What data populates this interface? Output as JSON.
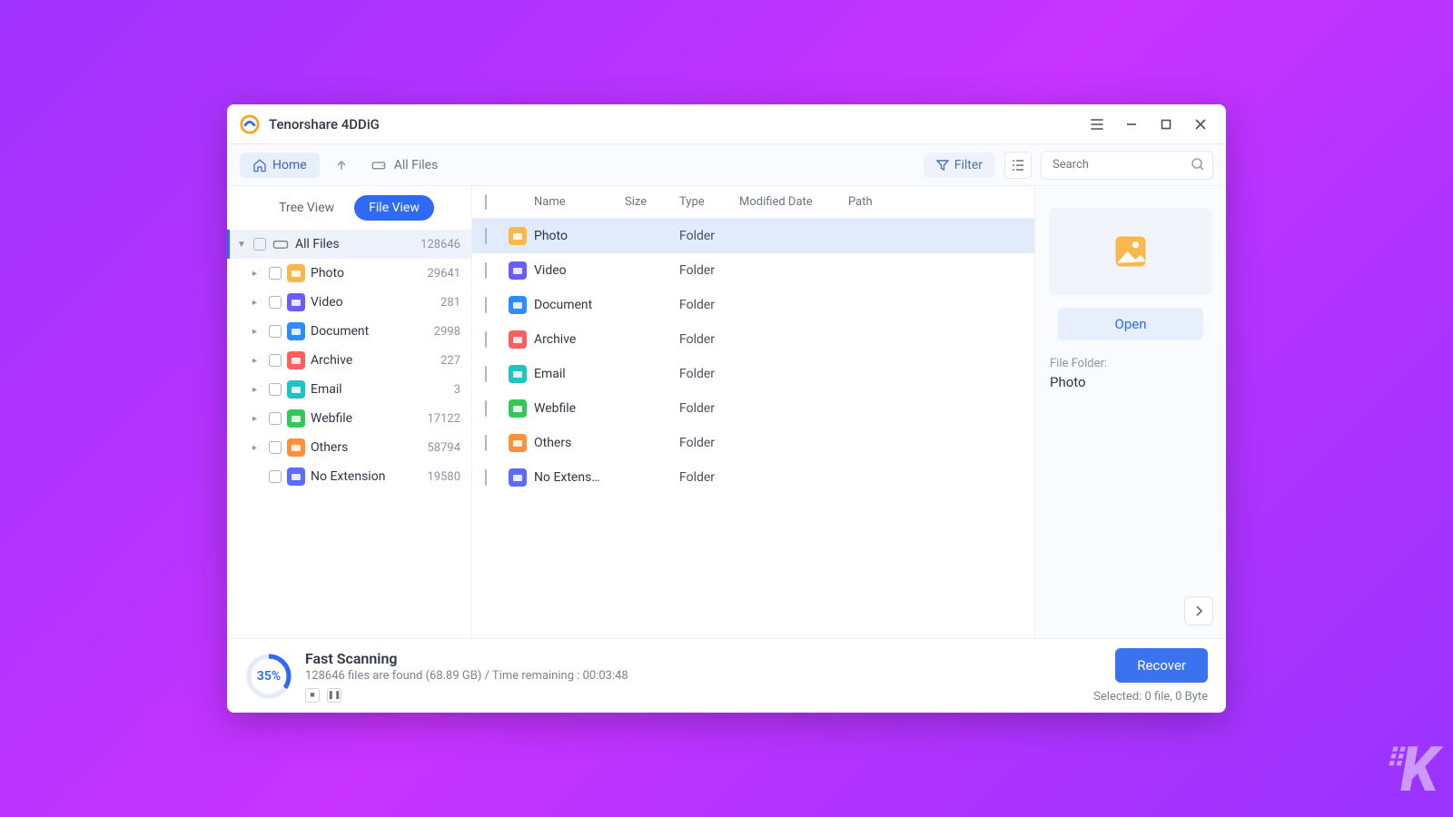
{
  "app_title": "Tenorshare 4DDiG",
  "toolbar": {
    "home": "Home",
    "breadcrumb": "All Files",
    "filter": "Filter",
    "search_placeholder": "Search"
  },
  "sidebar": {
    "tabs": {
      "tree": "Tree View",
      "file": "File View"
    },
    "root": {
      "label": "All Files",
      "count": "128646"
    },
    "items": [
      {
        "label": "Photo",
        "count": "29641",
        "color": "#f8b84e"
      },
      {
        "label": "Video",
        "count": "281",
        "color": "#6a5cff"
      },
      {
        "label": "Document",
        "count": "2998",
        "color": "#2f8cff"
      },
      {
        "label": "Archive",
        "count": "227",
        "color": "#ff5f5f"
      },
      {
        "label": "Email",
        "count": "3",
        "color": "#1fc6c1"
      },
      {
        "label": "Webfile",
        "count": "17122",
        "color": "#34c759"
      },
      {
        "label": "Others",
        "count": "58794",
        "color": "#ff9238"
      },
      {
        "label": "No Extension",
        "count": "19580",
        "color": "#5b6cff",
        "no_expand": true
      }
    ]
  },
  "columns": {
    "name": "Name",
    "size": "Size",
    "type": "Type",
    "modified": "Modified Date",
    "path": "Path"
  },
  "rows": [
    {
      "name": "Photo",
      "type": "Folder",
      "color": "#f8b84e",
      "selected": true
    },
    {
      "name": "Video",
      "type": "Folder",
      "color": "#6a5cff"
    },
    {
      "name": "Document",
      "type": "Folder",
      "color": "#2f8cff"
    },
    {
      "name": "Archive",
      "type": "Folder",
      "color": "#ff5f5f"
    },
    {
      "name": "Email",
      "type": "Folder",
      "color": "#1fc6c1"
    },
    {
      "name": "Webfile",
      "type": "Folder",
      "color": "#34c759"
    },
    {
      "name": "Others",
      "type": "Folder",
      "color": "#ff9238"
    },
    {
      "name": "No Extens…",
      "type": "Folder",
      "color": "#5b6cff"
    }
  ],
  "preview": {
    "open": "Open",
    "meta_label": "File Folder:",
    "meta_value": "Photo"
  },
  "status": {
    "pct": "35%",
    "title": "Fast Scanning",
    "sub": "128646 files are found (68.89 GB) /   Time remaining : 00:03:48",
    "recover": "Recover",
    "selected": "Selected: 0 file, 0 Byte"
  }
}
